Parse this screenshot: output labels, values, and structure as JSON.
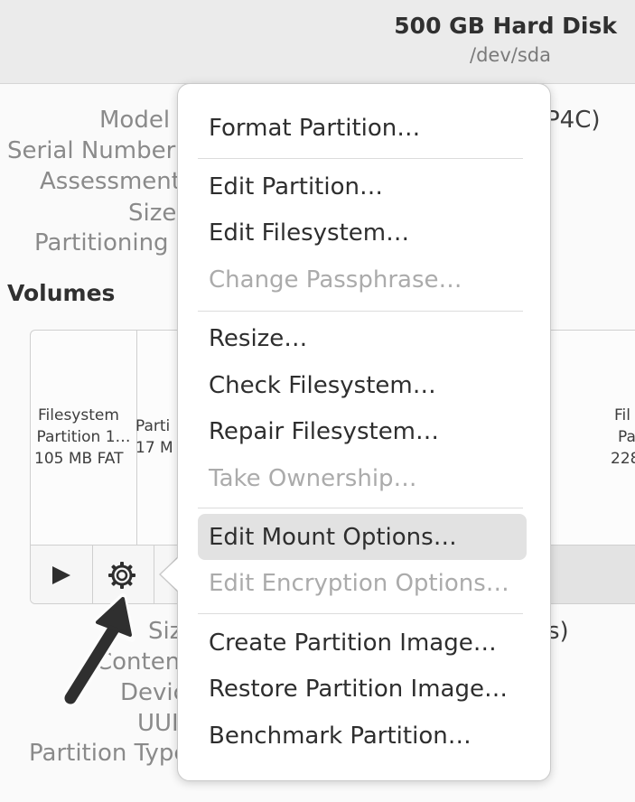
{
  "disk": {
    "title": "500 GB Hard Disk",
    "device": "/dev/sda"
  },
  "info_labels": {
    "model": "Model",
    "serial_number": "Serial Number",
    "assessment": "Assessment",
    "size": "Size",
    "partitioning": "Partitioning"
  },
  "model_value_tail": "P4C)",
  "volumes": {
    "heading": "Volumes",
    "seg1": {
      "line1": "Filesystem",
      "line2": "Partition 1…",
      "line3": "105 MB FAT"
    },
    "seg2": {
      "line1": "Parti",
      "line2": "17 M"
    },
    "seg3": {
      "line1": "Fil",
      "line2": "Pa",
      "line3": "228"
    }
  },
  "partition_labels": {
    "size": "Size",
    "contents": "Contents",
    "device": "Device",
    "uuid": "UUID",
    "partition_type": "Partition Type"
  },
  "size_value_tail": "s)",
  "menu": {
    "format_partition": "Format Partition…",
    "edit_partition": "Edit Partition…",
    "edit_filesystem": "Edit Filesystem…",
    "change_passphrase": "Change Passphrase…",
    "resize": "Resize…",
    "check_filesystem": "Check Filesystem…",
    "repair_filesystem": "Repair Filesystem…",
    "take_ownership": "Take Ownership…",
    "edit_mount_options": "Edit Mount Options…",
    "edit_encryption_options": "Edit Encryption Options…",
    "create_partition_image": "Create Partition Image…",
    "restore_partition_image": "Restore Partition Image…",
    "benchmark_partition": "Benchmark Partition…"
  },
  "colors": {
    "menu_highlight": "#e2e2e2",
    "disabled_text": "#ababab",
    "label_text": "#8a8a8a"
  },
  "icons": [
    "play-icon",
    "gear-icon",
    "pointer-arrow-icon"
  ]
}
